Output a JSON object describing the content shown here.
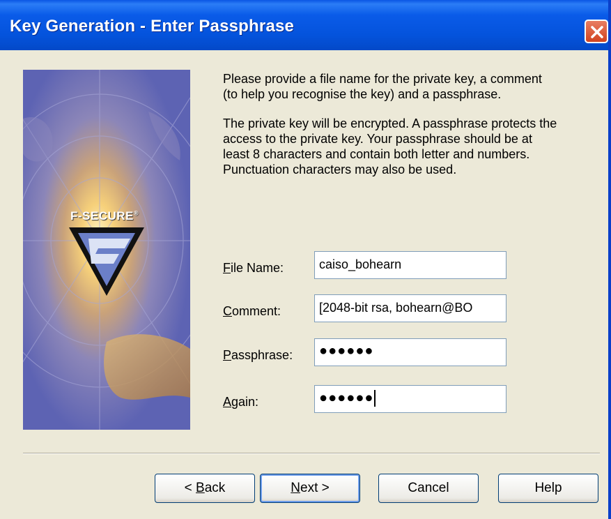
{
  "window": {
    "title": "Key Generation - Enter Passphrase"
  },
  "side_image": {
    "brand": "F-SECURE",
    "registered_mark": "®"
  },
  "instructions": {
    "paragraph1": "Please provide a file name for the private key, a comment (to help you recognise the key) and a passphrase.",
    "paragraph2": "The private key will be encrypted. A passphrase protects the access to the private key.  Your passphrase should be at least 8 characters and contain both letter and numbers. Punctuation characters may also be used."
  },
  "form": {
    "file_name": {
      "label_mnemonic": "F",
      "label_rest": "ile Name:",
      "value": "caiso_bohearn"
    },
    "comment": {
      "label_mnemonic": "C",
      "label_rest": "omment:",
      "value": "[2048-bit rsa, bohearn@BO"
    },
    "passphrase": {
      "label_mnemonic": "P",
      "label_rest": "assphrase:",
      "value": "●●●●●●"
    },
    "again": {
      "label_mnemonic": "A",
      "label_rest": "gain:",
      "value": "●●●●●●"
    }
  },
  "buttons": {
    "back": {
      "prefix": "< ",
      "mnemonic": "B",
      "rest": "ack"
    },
    "next": {
      "mnemonic": "N",
      "rest": "ext >"
    },
    "cancel": "Cancel",
    "help": "Help"
  },
  "colors": {
    "titlebar": "#0453DC",
    "dialog_bg": "#ECE9D8",
    "close_button": "#D2431F",
    "field_border": "#7F9DB9"
  },
  "icons": [
    "close-icon",
    "f-secure-logo"
  ]
}
